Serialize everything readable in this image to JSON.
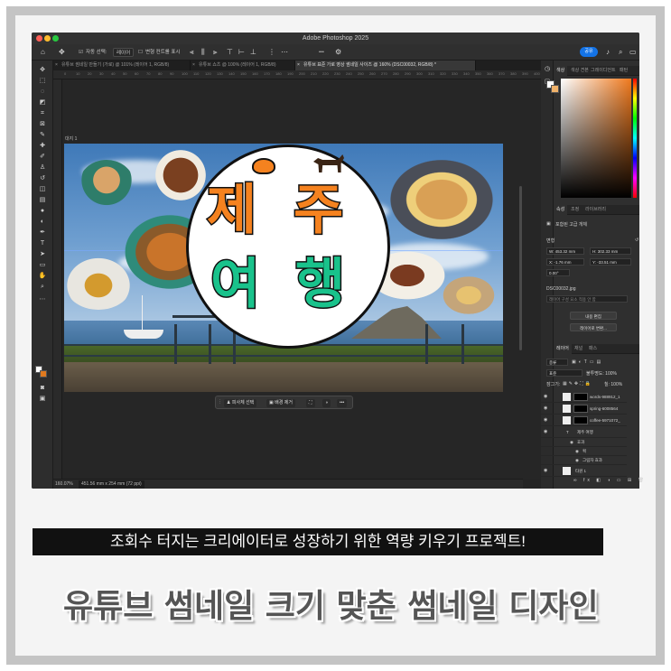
{
  "window": {
    "title": "Adobe Photoshop 2025",
    "share_label": "공유"
  },
  "options_bar": {
    "auto_select_label": "자동 선택:",
    "auto_select_value": "레이어",
    "transform_label": "변형 컨트롤 표시",
    "more_label": "•••"
  },
  "tabs": [
    {
      "label": "유튜브 썸네일 만들기 (가로) @ 101% (레이어 1, RGB/8)",
      "active": false
    },
    {
      "label": "유튜브 쇼츠 @ 100% (레이어 1, RGB/8)",
      "active": false
    },
    {
      "label": "유튜브 표준 가로 영상 썸네일 사이즈 @ 160% (DSC00032, RGB/8) *",
      "active": true
    }
  ],
  "ruler_ticks": [
    "0",
    "10",
    "20",
    "30",
    "40",
    "50",
    "60",
    "70",
    "80",
    "90",
    "100",
    "110",
    "120",
    "130",
    "140",
    "150",
    "160",
    "170",
    "180",
    "190",
    "200",
    "210",
    "220",
    "230",
    "240",
    "250",
    "260",
    "270",
    "280",
    "290",
    "300",
    "310",
    "320",
    "330",
    "340",
    "350",
    "360",
    "370",
    "380",
    "390",
    "400"
  ],
  "artboard": {
    "label": "대지 1"
  },
  "thumbnail": {
    "line1": [
      "제",
      "주"
    ],
    "line2": [
      "여",
      "행"
    ],
    "line1_color": "#f5821f",
    "line2_color": "#19c28b"
  },
  "context_bar": {
    "select_subject": "피사체 선택",
    "remove_bg": "배경 제거",
    "more": "•••"
  },
  "status": {
    "zoom": "160.07%",
    "doc_size": "451.56 mm x 254 mm (72 ppi)"
  },
  "color_panel": {
    "tabs": [
      "색상",
      "색상 견본",
      "그레이디언트",
      "패턴"
    ],
    "fg_color": "#ffffff",
    "bg_color": "#f0b26a"
  },
  "properties_panel": {
    "tabs": [
      "속성",
      "조정",
      "라이브러리"
    ],
    "layer_type": "포함된 고급 개체",
    "section_transform": "변형",
    "w": "W: 453.32 mm",
    "h": "H: 302.33 mm",
    "x": "X: -1.76 mm",
    "y": "Y: -33.51 mm",
    "angle": "0.00°",
    "file_name": "DSC00032.jpg",
    "file_hint": "레이어 구성 요소 적용 안 함",
    "edit_contents": "내용 편집",
    "convert_to_layers": "레이어로 변환..."
  },
  "layers_panel": {
    "tabs": [
      "레이어",
      "채널",
      "패스"
    ],
    "filter_label": "종류",
    "blend_mode": "표준",
    "opacity": "불투명도: 100%",
    "lock_label": "잠그기:",
    "fill": "칠: 100%",
    "layers": [
      {
        "name": "words-988912_1",
        "kind": "smart"
      },
      {
        "name": "spring-6008564",
        "kind": "smart"
      },
      {
        "name": "coffee-5971072_",
        "kind": "smart"
      },
      {
        "name": "제주 여행",
        "kind": "text"
      },
      {
        "name": "효과",
        "kind": "fx"
      },
      {
        "name": "획",
        "kind": "fx-item"
      },
      {
        "name": "그림자 효과",
        "kind": "fx-item"
      },
      {
        "name": "타원 1",
        "kind": "shape"
      }
    ]
  },
  "captions": {
    "subtitle": "조회수 터지는 크리에이터로 성장하기 위한 역량 키우기 프로젝트!",
    "headline": "유튜브 썸네일 크기 맞춘 썸네일 디자인"
  }
}
